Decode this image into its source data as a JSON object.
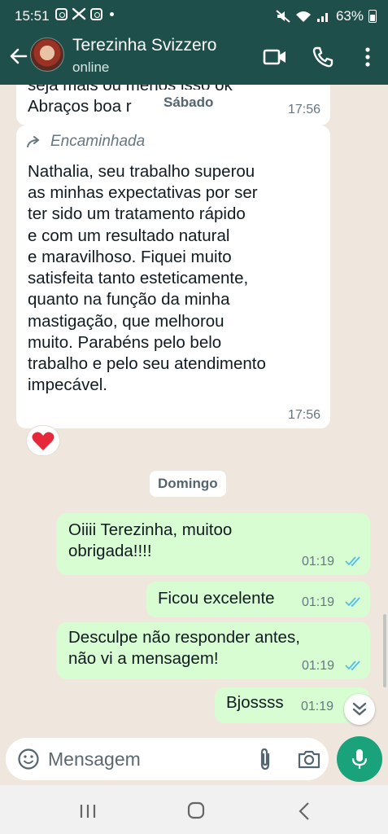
{
  "status_bar": {
    "time": "15:51",
    "battery": "63%"
  },
  "header": {
    "contact_name": "Terezinha Svizzero",
    "contact_status": "online"
  },
  "messages": [
    {
      "text": "seja mais ou menos isso ok\nAbraços  boa r",
      "time": "17:56",
      "direction": "in"
    },
    {
      "forwarded_label": "Encaminhada",
      "text": "Nathalia, seu trabalho superou\nas minhas expectativas por ser\nter sido um tratamento rápido\ne com um resultado natural\ne maravilhoso. Fiquei muito\nsatisfeita tanto esteticamente,\nquanto na função da minha\nmastigação, que melhorou\nmuito. Parabéns pelo belo\ntrabalho e pelo seu atendimento\nimpecável.",
      "time": "17:56",
      "direction": "in",
      "reaction": "❤️"
    },
    {
      "text": "Oiiii Terezinha, muitoo\nobrigada!!!!",
      "time": "01:19",
      "direction": "out",
      "status": "read"
    },
    {
      "text": "Ficou excelente",
      "time": "01:19",
      "direction": "out",
      "status": "read"
    },
    {
      "text": "Desculpe não responder antes,\nnão vi a mensagem!",
      "time": "01:19",
      "direction": "out",
      "status": "read"
    },
    {
      "text": "Bjossss",
      "time": "01:19",
      "direction": "out",
      "status": "read"
    }
  ],
  "day_chips": {
    "saturday": "Sábado",
    "sunday": "Domingo"
  },
  "input": {
    "placeholder": "Mensagem"
  },
  "colors": {
    "header_bg": "#1f4f4a",
    "incoming_bubble": "#ffffff",
    "outgoing_bubble": "#d9fdd3",
    "read_ticks": "#53bdeb",
    "mic_button": "#1aa37a",
    "chat_bg": "#efe7de"
  }
}
